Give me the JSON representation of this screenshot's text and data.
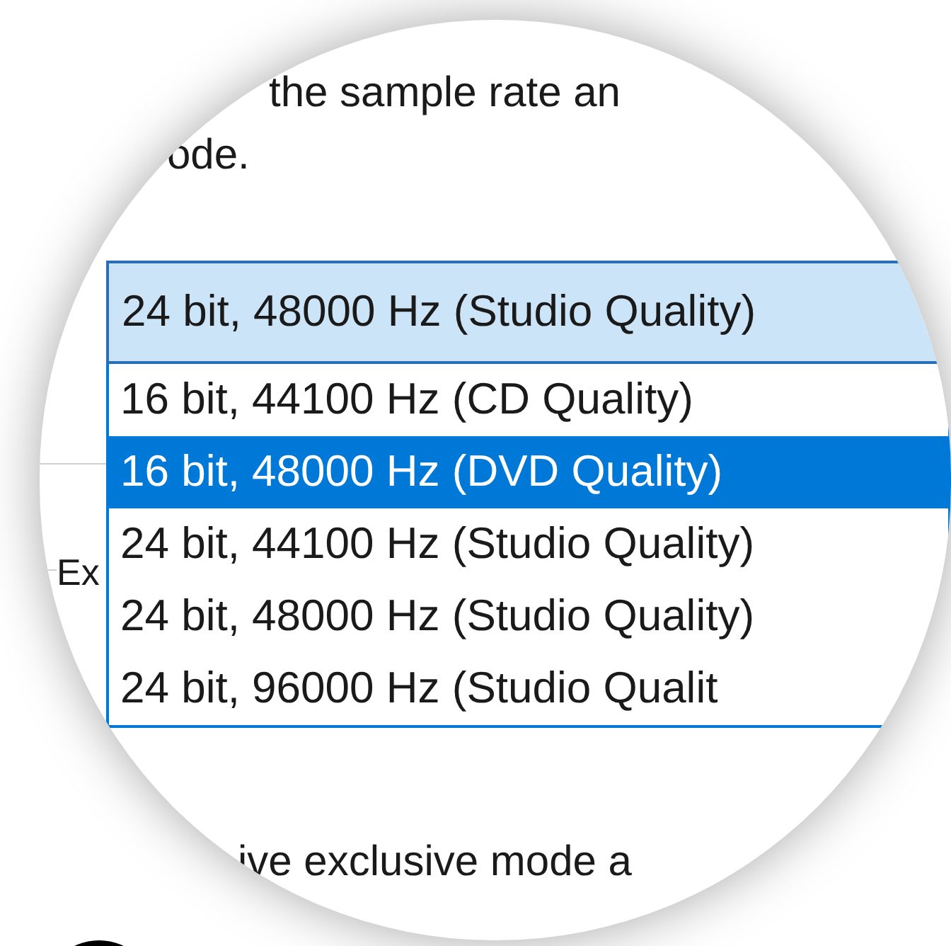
{
  "instruction_lines": [
    "the sample rate an",
    "ode."
  ],
  "format_dropdown": {
    "value": "24 bit, 48000 Hz (Studio Quality)",
    "expanded": true
  },
  "format_options": [
    {
      "label": "16 bit, 44100 Hz (CD Quality)",
      "selected": false
    },
    {
      "label": "16 bit, 48000 Hz (DVD Quality)",
      "selected": true
    },
    {
      "label": "24 bit, 44100 Hz (Studio Quality)",
      "selected": false
    },
    {
      "label": "24 bit, 48000 Hz (Studio Quality)",
      "selected": false
    },
    {
      "label": "24 bit, 96000 Hz (Studio Qualit",
      "selected": false
    }
  ],
  "group_label": "Ex",
  "footer_text": "ive exclusive mode a"
}
